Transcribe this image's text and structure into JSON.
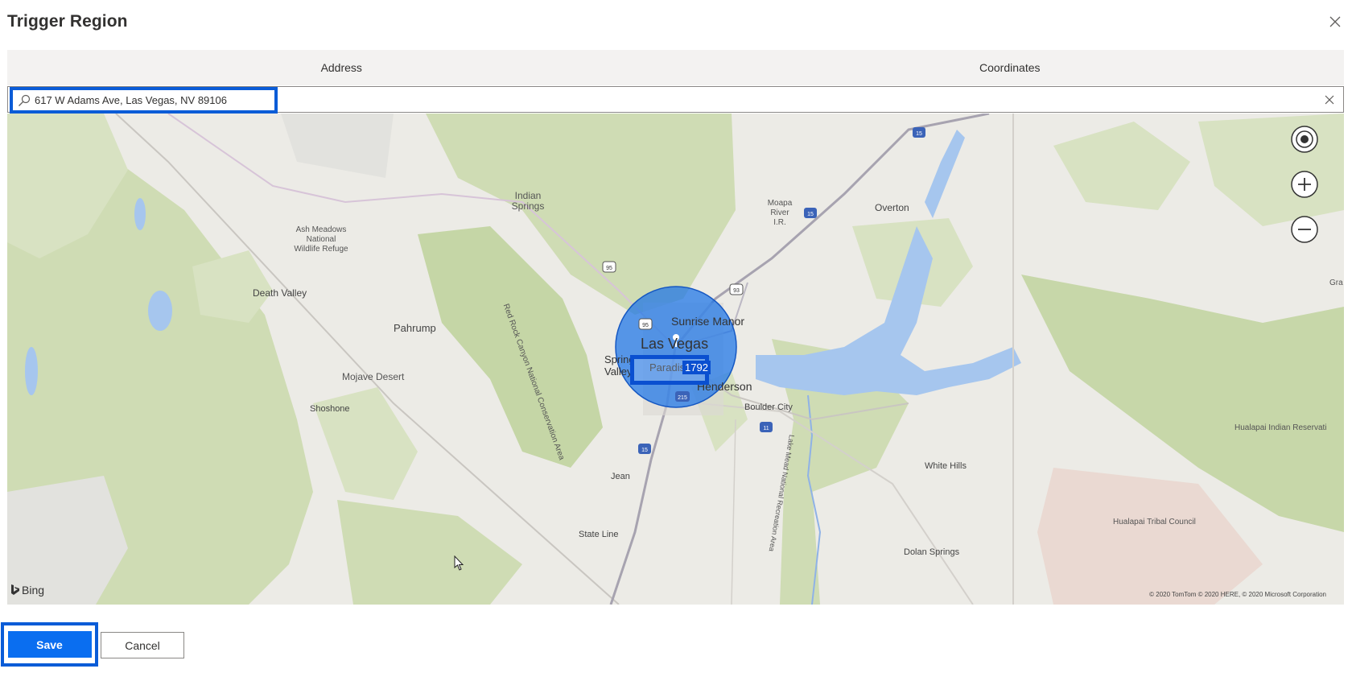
{
  "dialog": {
    "title": "Trigger Region"
  },
  "tabs": [
    {
      "label": "Address"
    },
    {
      "label": "Coordinates"
    }
  ],
  "search": {
    "value": "617 W Adams Ave, Las Vegas, NV 89106",
    "placeholder": ""
  },
  "map": {
    "provider": "Bing",
    "copyright": "© 2020 TomTom © 2020 HERE, © 2020 Microsoft Corporation",
    "radius_label": "1792",
    "region_color": "#1a73e8",
    "labels": {
      "indian_springs": "Indian Springs",
      "ash_meadows": "Ash Meadows National Wildlife Refuge",
      "death_valley": "Death Valley",
      "pahrump": "Pahrump",
      "mojave": "Mojave Desert",
      "shoshone": "Shoshone",
      "red_rock": "Red Rock Canyon National Conservation Area",
      "moapa": "Moapa River I.R.",
      "overton": "Overton",
      "sunrise_manor": "Sunrise Manor",
      "las_vegas": "Las Vegas",
      "spring_valley": "Spring Valley",
      "paradise": "Paradise",
      "henderson": "Henderson",
      "boulder_city": "Boulder City",
      "jean": "Jean",
      "state_line": "State Line",
      "white_hills": "White Hills",
      "dolan_springs": "Dolan Springs",
      "lake_mead": "Lake Mead National Recreation Area",
      "hualapai_res": "Hualapai Indian Reservati",
      "hualapai_council": "Hualapai Tribal Council",
      "grand": "Gra"
    },
    "highways": [
      "15",
      "93",
      "95",
      "11",
      "215"
    ],
    "controls": [
      "locate-icon",
      "zoom-in-icon",
      "zoom-out-icon"
    ]
  },
  "buttons": {
    "save": "Save",
    "cancel": "Cancel"
  }
}
